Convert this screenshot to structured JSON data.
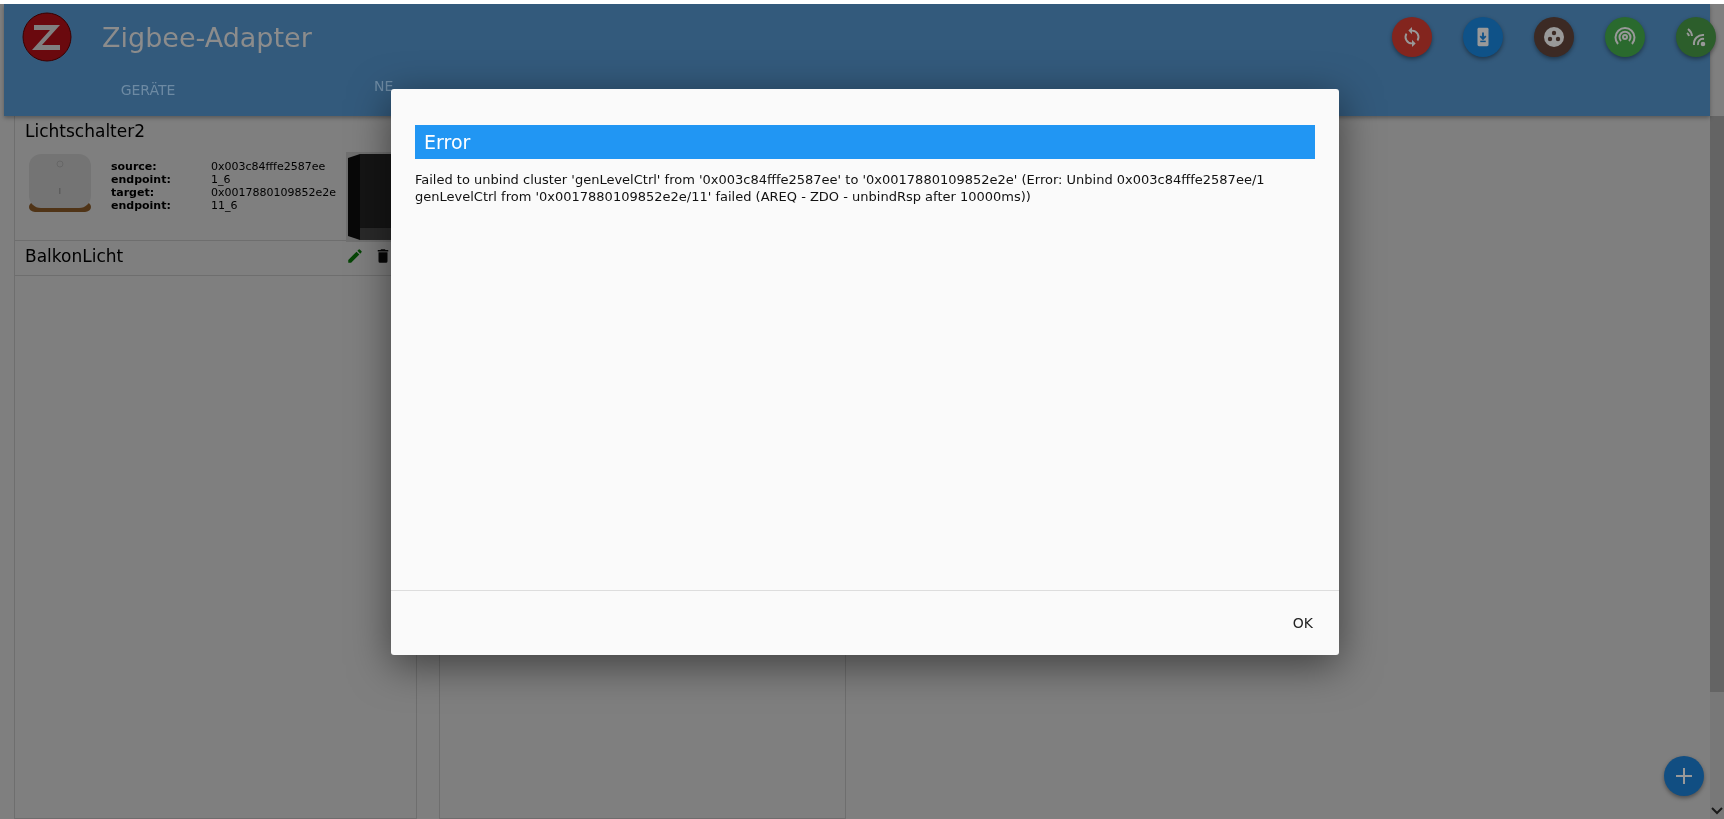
{
  "header": {
    "title": "Zigbee-Adapter",
    "actions": [
      {
        "color": "#83251e",
        "kind": "refresh"
      },
      {
        "color": "#0f5288",
        "kind": "install"
      },
      {
        "color": "#3c2a24",
        "kind": "groups"
      },
      {
        "color": "#2a6a2e",
        "kind": "pairing"
      },
      {
        "color": "#2c5e2b",
        "kind": "signal"
      }
    ]
  },
  "tabs": [
    {
      "label": "GERÄTE"
    },
    {
      "label": "NE"
    }
  ],
  "bindings": [
    {
      "name": "Lichtschalter2",
      "details": [
        {
          "label": "source:",
          "value": "0x003c84fffe2587ee"
        },
        {
          "label": "endpoint:",
          "value": "1_6"
        },
        {
          "label": "target:",
          "value": "0x0017880109852e2e"
        },
        {
          "label": "endpoint:",
          "value": "11_6"
        }
      ]
    },
    {
      "name": "BalkonLicht"
    }
  ],
  "dialog": {
    "title": "Error",
    "message": "Failed to unbind cluster 'genLevelCtrl' from '0x003c84fffe2587ee' to '0x0017880109852e2e' (Error: Unbind 0x003c84fffe2587ee/1 genLevelCtrl from '0x0017880109852e2e/11' failed (AREQ - ZDO - unbindRsp after 10000ms))",
    "buttons": [
      "OK"
    ]
  }
}
